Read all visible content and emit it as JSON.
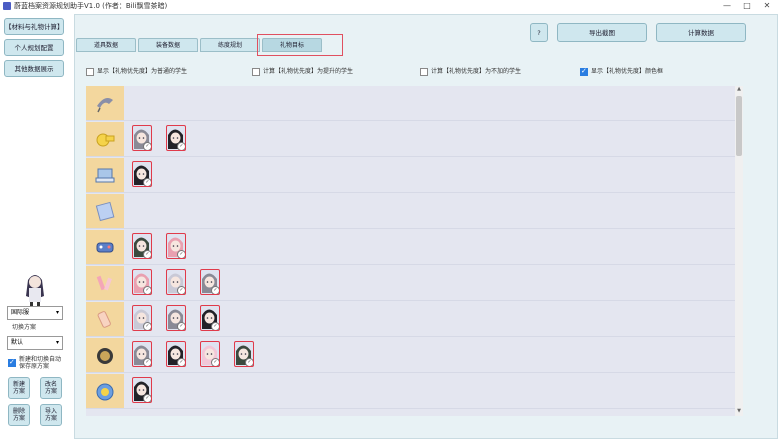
{
  "window": {
    "title": "蔚蓝档案资源规划助手V1.0 (作者：Bili飘雪茶暗)",
    "controls": [
      "—",
      "□",
      "✕"
    ]
  },
  "sidebar": {
    "nav": [
      "【材料与礼物计算】",
      "个人规划配置",
      "其他数据展示"
    ],
    "server_select": "国际服",
    "plan_switch_label": "切换方案",
    "plan_select": "默认",
    "auto_save_label": "新建和切换自动保存原方案",
    "buttons": [
      [
        "新建",
        "方案"
      ],
      [
        "改名",
        "方案"
      ],
      [
        "删除",
        "方案"
      ],
      [
        "导入",
        "方案"
      ]
    ]
  },
  "tabs": [
    "道具数据",
    "装备数据",
    "练度规划",
    "礼物目标"
  ],
  "active_tab": 3,
  "toolbar": {
    "help": "?",
    "export": "导出截图",
    "calc": "计算数据"
  },
  "options": [
    {
      "label": "显示【礼物优先度】为普通的学生",
      "checked": false
    },
    {
      "label": "计算【礼物优先度】为提升的学生",
      "checked": false
    },
    {
      "label": "计算【礼物优先度】为不加的学生",
      "checked": false
    },
    {
      "label": "显示【礼物优先度】颜色框",
      "checked": true
    }
  ],
  "gift_rows": [
    {
      "gift": "ribbon-gift-icon",
      "students": 0
    },
    {
      "gift": "whistle-gift-icon",
      "students": 2
    },
    {
      "gift": "laptop-gift-icon",
      "students": 1
    },
    {
      "gift": "book-gift-icon",
      "students": 0
    },
    {
      "gift": "game-console-gift-icon",
      "students": 2
    },
    {
      "gift": "cosmetics-gift-icon",
      "students": 3
    },
    {
      "gift": "lotion-gift-icon",
      "students": 3
    },
    {
      "gift": "compact-gift-icon",
      "students": 4
    },
    {
      "gift": "candy-gift-icon",
      "students": 1
    }
  ],
  "colors": {
    "accent": "#cfe7ee",
    "highlight": "#e05060",
    "student_frame": "#e03a4a",
    "gift_bg": "#f3d79e"
  }
}
